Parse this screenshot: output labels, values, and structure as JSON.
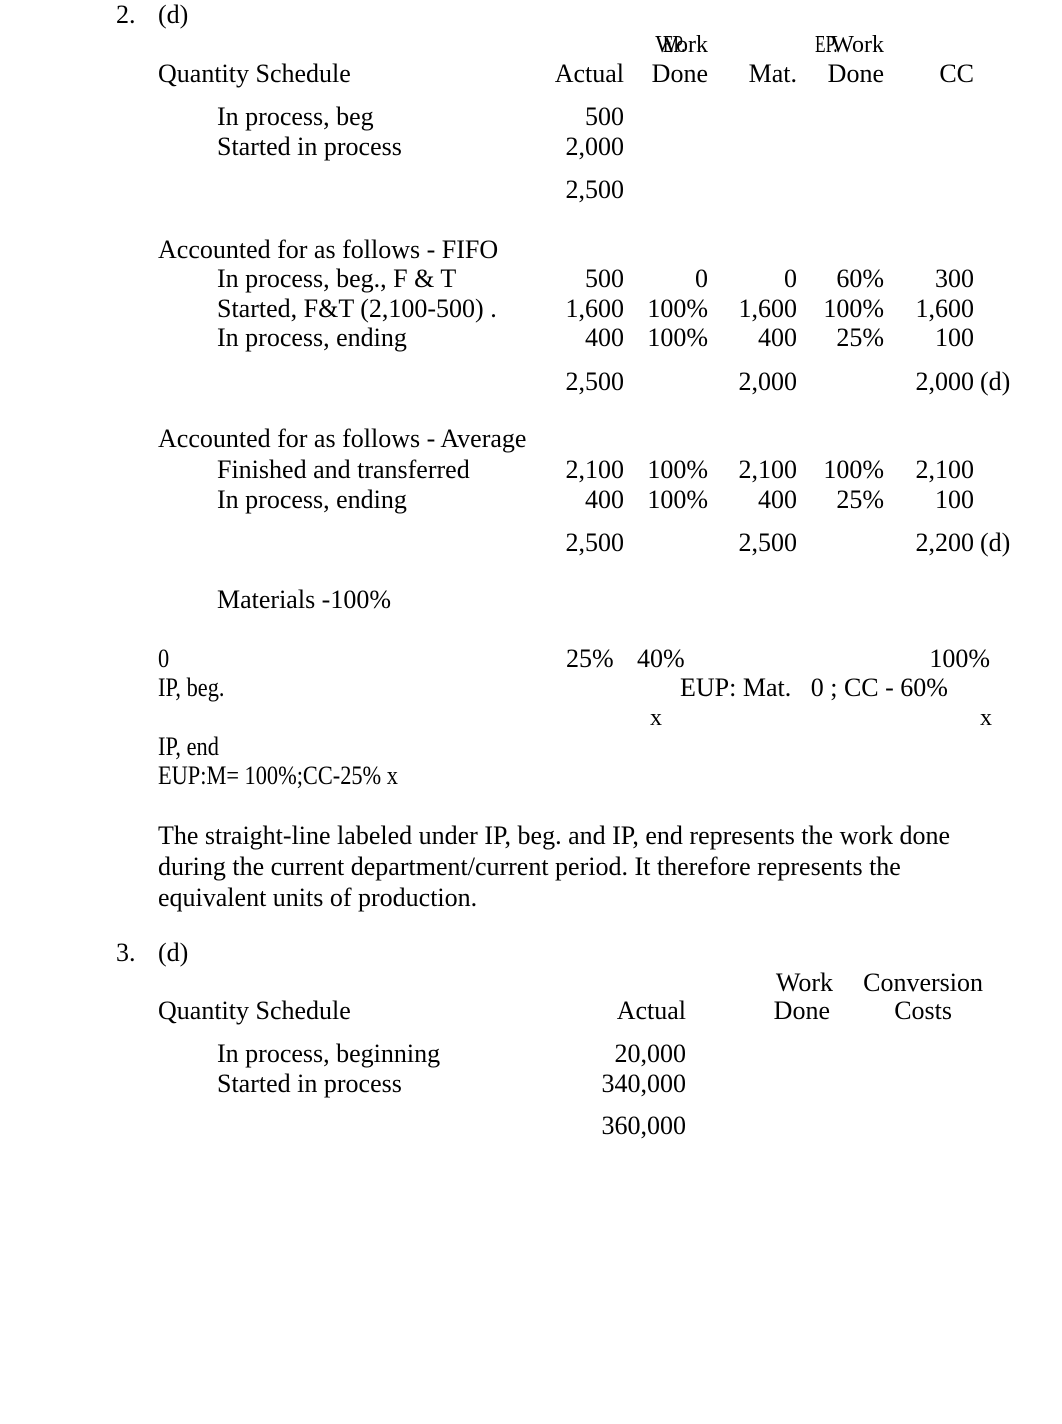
{
  "document": {
    "title": "Process Costing Solution Notes",
    "page_background": "#ffffff",
    "text_color": "#000000"
  },
  "items": [
    {
      "number": "2.",
      "answer": "(d)",
      "schedule": {
        "title": "Quantity Schedule",
        "column_headers_top": [
          "",
          "Work",
          "EP.",
          "Work",
          "EP."
        ],
        "column_headers_bottom": [
          "Actual",
          "Done",
          "Mat.",
          "Done",
          "CC"
        ],
        "intro_rows": [
          {
            "label": "In process, beg",
            "actual": "500",
            "wd1": "",
            "ep_mat": "",
            "wd2": "",
            "ep_cc": ""
          },
          {
            "label": "Started in process",
            "actual": "2,000",
            "wd1": "",
            "ep_mat": "",
            "wd2": "",
            "ep_cc": ""
          }
        ],
        "intro_total": {
          "actual": "2,500",
          "ep_mat": "",
          "ep_cc": ""
        },
        "sections": [
          {
            "heading": "Accounted for as follows - FIFO",
            "rows": [
              {
                "label": "In process, beg., F & T",
                "actual": "500",
                "wd1": "0",
                "ep_mat": "0",
                "wd2": "60%",
                "ep_cc": "300"
              },
              {
                "label": "Started, F&T (2,100-500) .",
                "actual": "1,600",
                "wd1": "100%",
                "ep_mat": "1,600",
                "wd2": "100%",
                "ep_cc": "1,600"
              },
              {
                "label": "In process, ending",
                "actual": "400",
                "wd1": "100%",
                "ep_mat": "400",
                "wd2": "25%",
                "ep_cc": "100"
              }
            ],
            "total": {
              "actual": "2,500",
              "ep_mat": "2,000",
              "ep_cc": "2,000",
              "ep_cc_suffix": "(d)"
            }
          },
          {
            "heading": "Accounted for as follows - Average",
            "rows": [
              {
                "label": "Finished and transferred",
                "actual": "2,100",
                "wd1": "100%",
                "ep_mat": "2,100",
                "wd2": "100%",
                "ep_cc": "2,100"
              },
              {
                "label": "In process, ending",
                "actual": "400",
                "wd1": "100%",
                "ep_mat": "400",
                "wd2": "25%",
                "ep_cc": "100"
              }
            ],
            "total": {
              "actual": "2,500",
              "ep_mat": "2,500",
              "ep_cc": "2,200",
              "ep_cc_suffix": "(d)"
            }
          }
        ],
        "materials_note": "Materials -100%"
      },
      "timeline": {
        "start_label": "0",
        "tick_25": "25%",
        "tick_40": "40%",
        "tick_100": "100%",
        "beg_label": "IP, beg.",
        "eup_beg": "EUP: Mat.   0 ; CC - 60%",
        "x_left": "x",
        "x_right": "x",
        "end_label": "IP, end",
        "eup_end": "EUP:M= 100%;CC-25% x"
      },
      "explanation": "The straight-line labeled under IP,      beg.   and IP, end represents the work done during the current department/current period. It therefore represents the equivalent units of production."
    },
    {
      "number": "3.",
      "answer": "(d)",
      "schedule": {
        "title": "Quantity Schedule",
        "column_headers_top": [
          "",
          "Work",
          "Conversion"
        ],
        "column_headers_bottom": [
          "Actual",
          "Done",
          "Costs"
        ],
        "intro_rows": [
          {
            "label": "In process, beginning",
            "actual": "20,000",
            "wd1": "",
            "cc": ""
          },
          {
            "label": "Started in process",
            "actual": "340,000",
            "wd1": "",
            "cc": ""
          }
        ],
        "intro_total": {
          "actual": "360,000"
        }
      }
    }
  ]
}
